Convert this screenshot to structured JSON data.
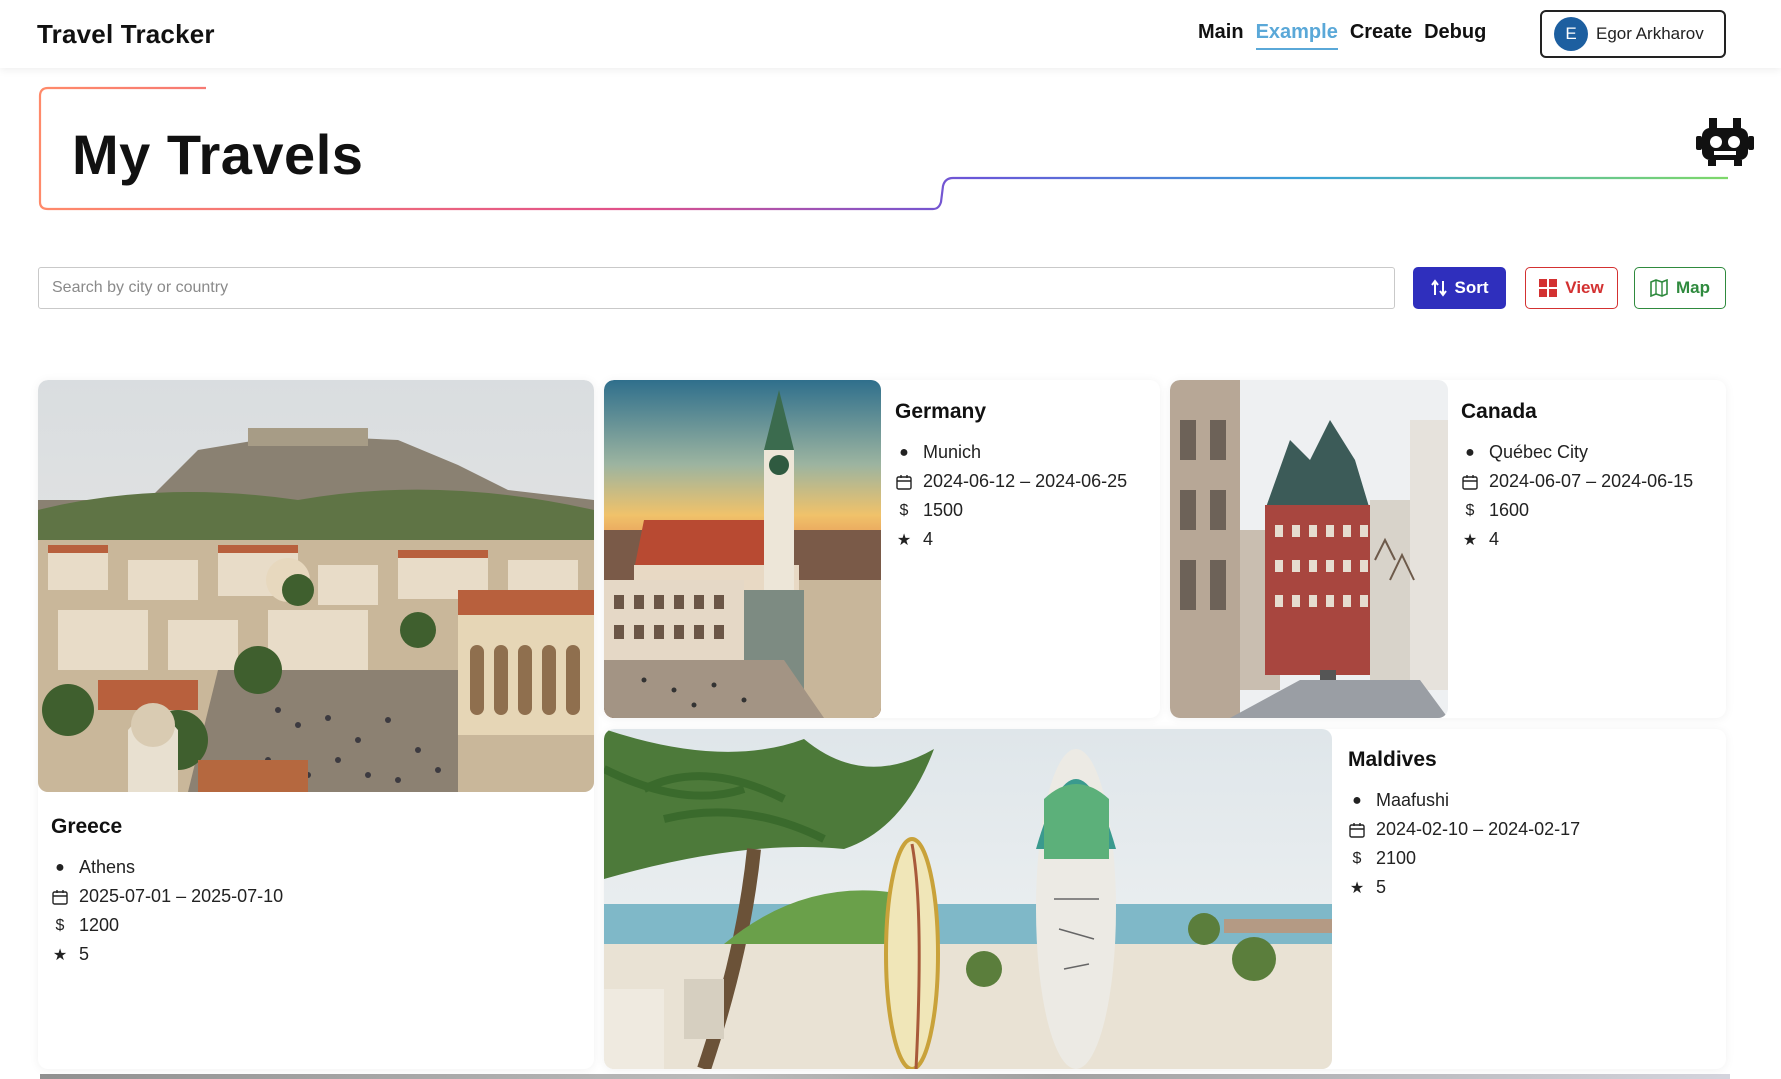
{
  "app": {
    "title": "Travel Tracker"
  },
  "nav": {
    "items": [
      {
        "label": "Main",
        "active": false
      },
      {
        "label": "Example",
        "active": true
      },
      {
        "label": "Create",
        "active": false
      },
      {
        "label": "Debug",
        "active": false
      }
    ]
  },
  "user": {
    "initial": "E",
    "name": "Egor Arkharov"
  },
  "page": {
    "title": "My Travels"
  },
  "search": {
    "placeholder": "Search by city or country",
    "value": ""
  },
  "toolbar": {
    "sort_label": "Sort",
    "view_label": "View",
    "map_label": "Map"
  },
  "colors": {
    "sort": "#2f2fbd",
    "view": "#d33131",
    "map": "#2f8a3e",
    "active_nav": "#5aa8d8"
  },
  "trips": [
    {
      "country": "Greece",
      "city": "Athens",
      "dates": "2025-07-01 – 2025-07-10",
      "cost": "1200",
      "rating": "5"
    },
    {
      "country": "Germany",
      "city": "Munich",
      "dates": "2024-06-12 – 2024-06-25",
      "cost": "1500",
      "rating": "4"
    },
    {
      "country": "Canada",
      "city": "Québec City",
      "dates": "2024-06-07 – 2024-06-15",
      "cost": "1600",
      "rating": "4"
    },
    {
      "country": "Maldives",
      "city": "Maafushi",
      "dates": "2024-02-10 – 2024-02-17",
      "cost": "2100",
      "rating": "5"
    }
  ],
  "icons": {
    "city": "globe-icon",
    "dates": "calendar-icon",
    "cost": "dollar-icon",
    "rating": "star-icon"
  }
}
